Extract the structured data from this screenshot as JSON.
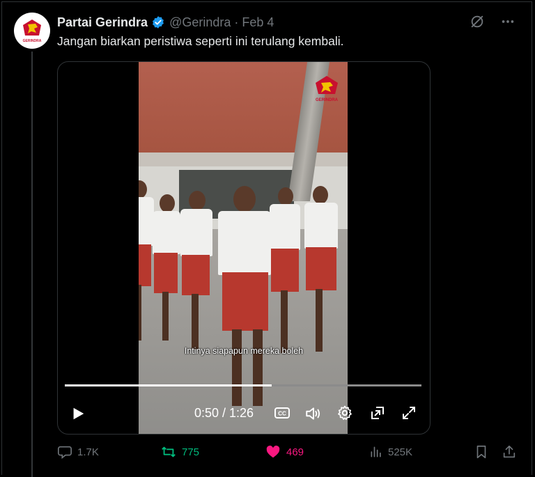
{
  "tweet": {
    "author_name": "Partai Gerindra",
    "handle": "@Gerindra",
    "separator": "·",
    "date": "Feb 4",
    "text": "Jangan biarkan peristiwa seperti ini terulang kembali.",
    "avatar_logo_text": "GERINDRA"
  },
  "video": {
    "watermark_text": "GERINDRA",
    "subtitle": "Intinya siapapun mereka boleh",
    "time_display": "0:50 / 1:26",
    "progress_fraction": 0.581
  },
  "actions": {
    "replies": "1.7K",
    "reposts": "775",
    "likes": "469",
    "views": "525K"
  },
  "colors": {
    "background": "#000000",
    "text_primary": "#e7e9ea",
    "text_secondary": "#71767b",
    "verified_blue": "#1d9bf0",
    "repost_green": "#00ba7c",
    "like_pink": "#f91880",
    "brand_red": "#c8102e"
  },
  "icons": [
    "grok-icon",
    "more-icon",
    "verified-icon",
    "play-icon",
    "captions-icon",
    "volume-icon",
    "settings-icon",
    "pip-icon",
    "fullscreen-icon",
    "reply-icon",
    "repost-icon",
    "like-icon",
    "views-icon",
    "bookmark-icon",
    "share-icon"
  ]
}
